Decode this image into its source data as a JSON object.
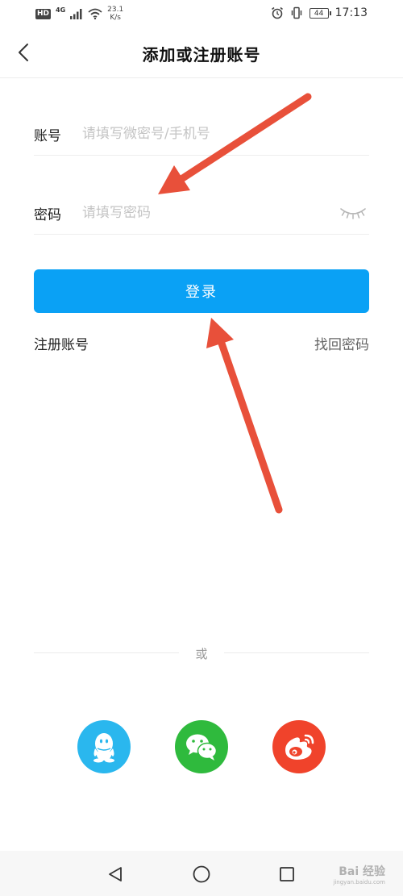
{
  "status_bar": {
    "hd": "HD",
    "network": "4G",
    "speed_value": "23.1",
    "speed_unit": "K/s",
    "battery": "44",
    "time": "17:13"
  },
  "header": {
    "title": "添加或注册账号"
  },
  "form": {
    "account_label": "账号",
    "account_placeholder": "请填写微密号/手机号",
    "password_label": "密码",
    "password_placeholder": "请填写密码",
    "login_label": "登录"
  },
  "links": {
    "register": "注册账号",
    "forgot": "找回密码"
  },
  "divider": {
    "or_text": "或"
  },
  "social": {
    "icons": [
      "qq-icon",
      "wechat-icon",
      "weibo-icon"
    ]
  },
  "watermark": {
    "brand": "Bai 经验",
    "site": "jingyan.baidu.com"
  },
  "colors": {
    "primary": "#0aa1f5",
    "qq": "#2ab7ee",
    "wechat": "#2fba3d",
    "weibo": "#f0432b",
    "annotation_arrow": "#e8503a"
  }
}
